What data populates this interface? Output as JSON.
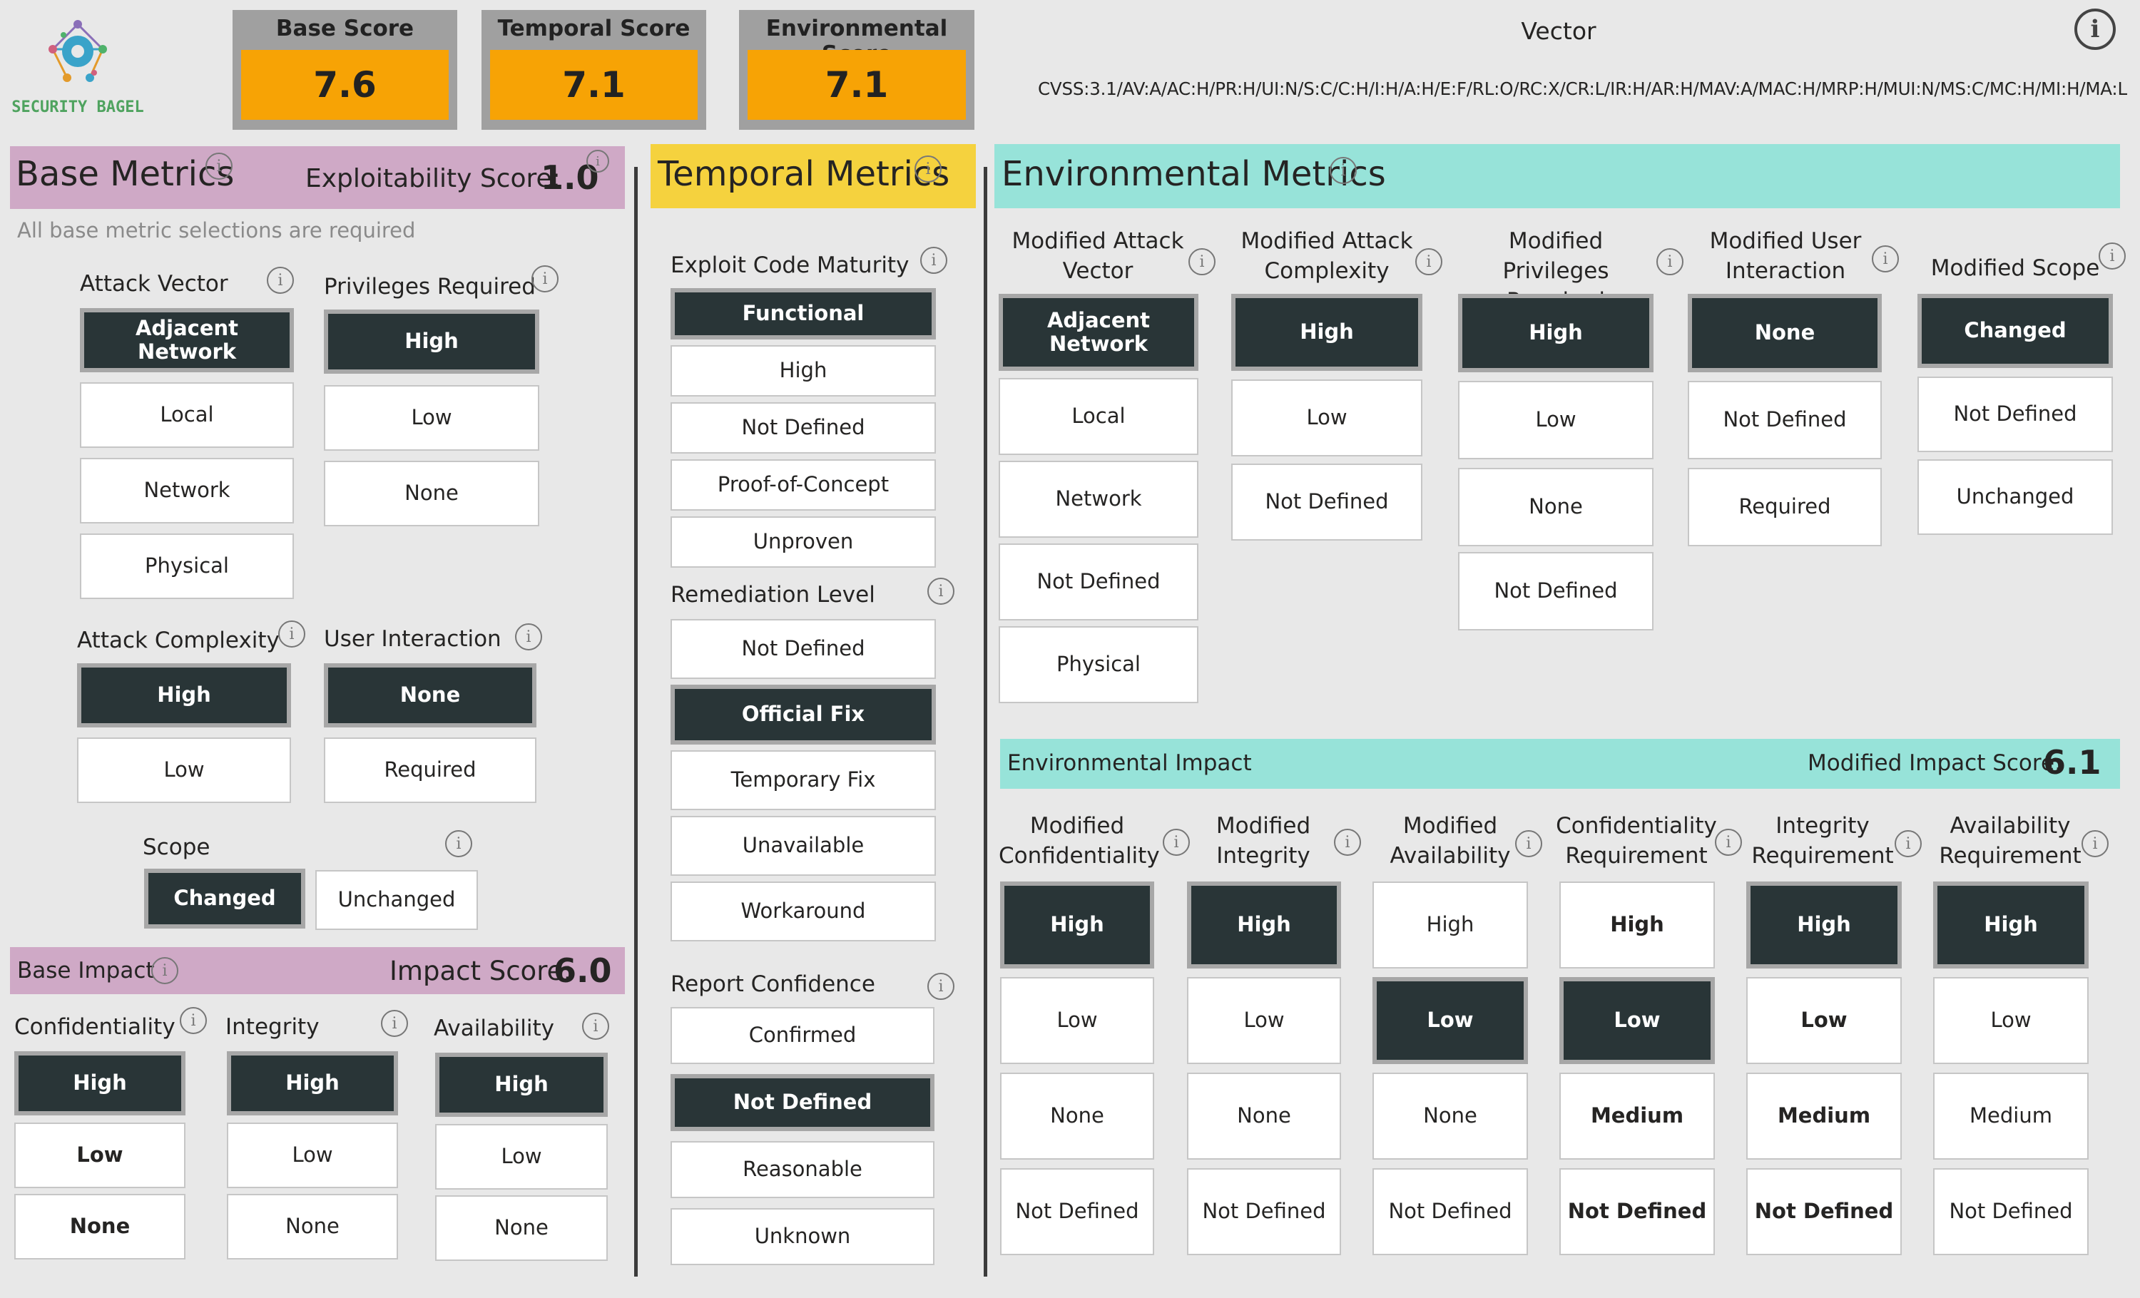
{
  "brand": {
    "name": "SECURITY BAGEL"
  },
  "scores": {
    "base": {
      "title": "Base Score",
      "value": "7.6"
    },
    "temporal": {
      "title": "Temporal Score",
      "value": "7.1"
    },
    "environmental": {
      "title": "Environmental Score",
      "value": "7.1"
    }
  },
  "vector": {
    "label": "Vector",
    "string": "CVSS:3.1/AV:A/AC:H/PR:H/UI:N/S:C/C:H/I:H/A:H/E:F/RL:O/RC:X/CR:L/IR:H/AR:H/MAV:A/MAC:H/MRP:H/MUI:N/MS:C/MC:H/MI:H/MA:L"
  },
  "info_glyph": "i",
  "base": {
    "title": "Base Metrics",
    "exploitability_label": "Exploitability Score:",
    "exploitability_value": "1.0",
    "note": "All base metric selections are required",
    "attack_vector": {
      "label": "Attack Vector",
      "options": [
        "Adjacent Network",
        "Local",
        "Network",
        "Physical"
      ],
      "selected": "Adjacent Network"
    },
    "privileges_required": {
      "label": "Privileges Required",
      "options": [
        "High",
        "Low",
        "None"
      ],
      "selected": "High"
    },
    "attack_complexity": {
      "label": "Attack Complexity",
      "options": [
        "High",
        "Low"
      ],
      "selected": "High"
    },
    "user_interaction": {
      "label": "User Interaction",
      "options": [
        "None",
        "Required"
      ],
      "selected": "None"
    },
    "scope": {
      "label": "Scope",
      "options": [
        "Changed",
        "Unchanged"
      ],
      "selected": "Changed"
    },
    "impact": {
      "title": "Base Impact",
      "score_label": "Impact Score:",
      "score_value": "6.0",
      "confidentiality": {
        "label": "Confidentiality",
        "options": [
          "High",
          "Low",
          "None"
        ],
        "selected": "High"
      },
      "integrity": {
        "label": "Integrity",
        "options": [
          "High",
          "Low",
          "None"
        ],
        "selected": "High"
      },
      "availability": {
        "label": "Availability",
        "options": [
          "High",
          "Low",
          "None"
        ],
        "selected": "High"
      }
    }
  },
  "temporal": {
    "title": "Temporal Metrics",
    "exploit_code_maturity": {
      "label": "Exploit Code Maturity",
      "options": [
        "Functional",
        "High",
        "Not Defined",
        "Proof-of-Concept",
        "Unproven"
      ],
      "selected": "Functional"
    },
    "remediation_level": {
      "label": "Remediation Level",
      "options": [
        "Not Defined",
        "Official Fix",
        "Temporary Fix",
        "Unavailable",
        "Workaround"
      ],
      "selected": "Official Fix"
    },
    "report_confidence": {
      "label": "Report Confidence",
      "options": [
        "Confirmed",
        "Not Defined",
        "Reasonable",
        "Unknown"
      ],
      "selected": "Not Defined"
    }
  },
  "environmental": {
    "title": "Environmental Metrics",
    "mav": {
      "label": "Modified Attack Vector",
      "options": [
        "Adjacent Network",
        "Local",
        "Network",
        "Not Defined",
        "Physical"
      ],
      "selected": "Adjacent Network"
    },
    "mac": {
      "label": "Modified Attack Complexity",
      "options": [
        "High",
        "Low",
        "Not Defined"
      ],
      "selected": "High"
    },
    "mpr": {
      "label": "Modified Privileges Required",
      "options": [
        "High",
        "Low",
        "None",
        "Not Defined"
      ],
      "selected": "High"
    },
    "mui": {
      "label": "Modified User Interaction",
      "options": [
        "None",
        "Not Defined",
        "Required"
      ],
      "selected": "None"
    },
    "ms": {
      "label": "Modified Scope",
      "options": [
        "Changed",
        "Not Defined",
        "Unchanged"
      ],
      "selected": "Changed"
    },
    "impact": {
      "title": "Environmental Impact",
      "score_label": "Modified Impact Score:",
      "score_value": "6.1",
      "mc": {
        "label": "Modified Confidentiality",
        "options": [
          "High",
          "Low",
          "None",
          "Not Defined"
        ],
        "selected": "High"
      },
      "mi": {
        "label": "Modified Integrity",
        "options": [
          "High",
          "Low",
          "None",
          "Not Defined"
        ],
        "selected": "High"
      },
      "ma": {
        "label": "Modified Availability",
        "options": [
          "High",
          "Low",
          "None",
          "Not Defined"
        ],
        "selected": "Low"
      },
      "cr": {
        "label": "Confidentiality Requirement",
        "options": [
          "High",
          "Low",
          "Medium",
          "Not Defined"
        ],
        "selected": "Low"
      },
      "ir": {
        "label": "Integrity Requirement",
        "options": [
          "High",
          "Low",
          "Medium",
          "Not Defined"
        ],
        "selected": "High"
      },
      "ar": {
        "label": "Availability Requirement",
        "options": [
          "High",
          "Low",
          "Medium",
          "Not Defined"
        ],
        "selected": "High"
      }
    }
  },
  "colors": {
    "base_band": "#cfa9c6",
    "temporal_band": "#f5d23e",
    "environmental_band": "#97e3d9",
    "score_fill": "#f7a305",
    "selected_fill": "#293537"
  }
}
